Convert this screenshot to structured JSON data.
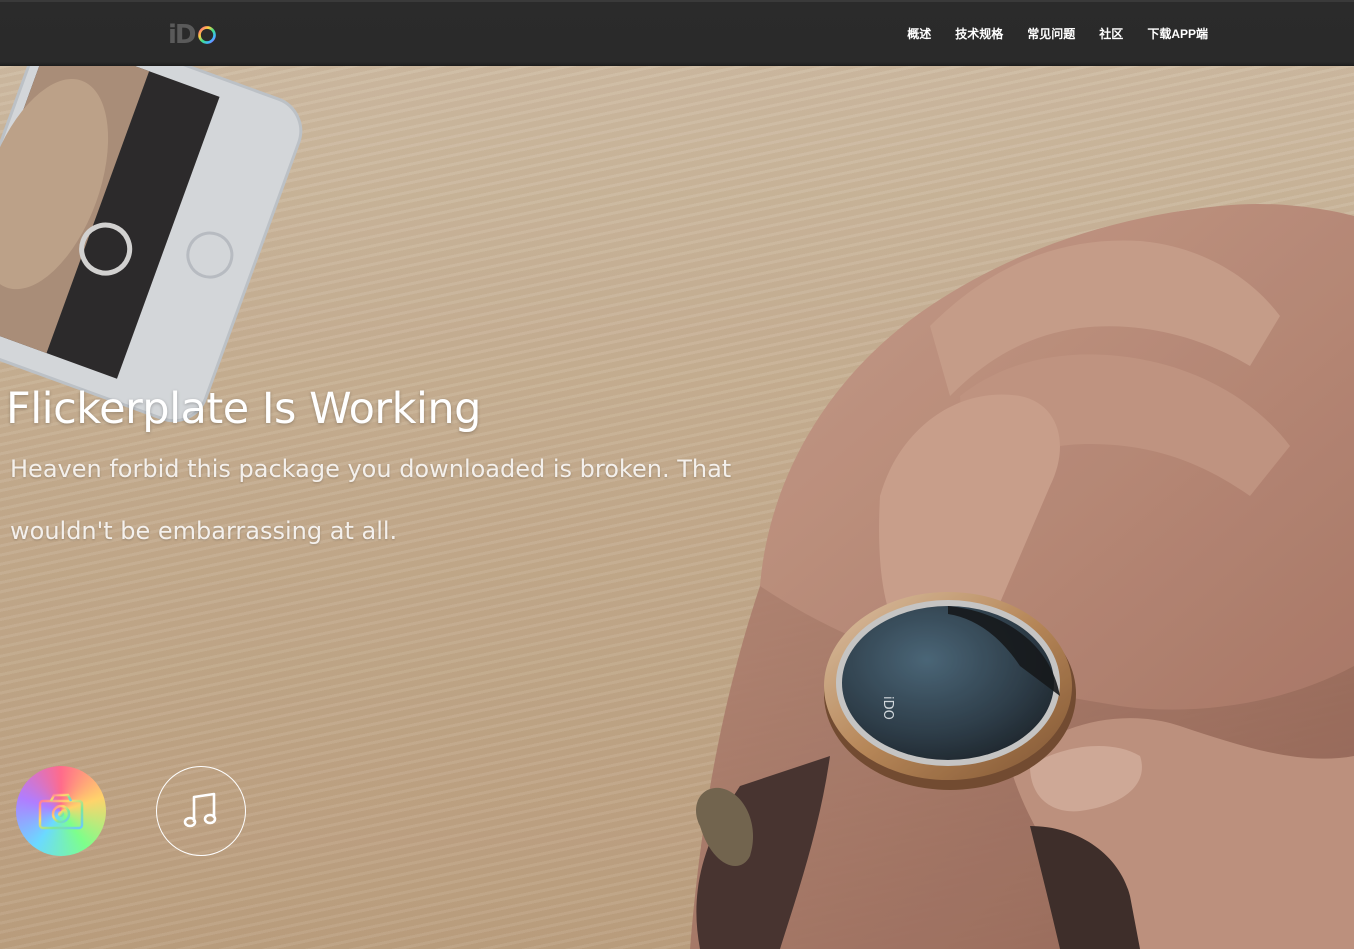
{
  "header": {
    "logo_text": "iD",
    "nav": [
      {
        "label": "概述"
      },
      {
        "label": "技术规格"
      },
      {
        "label": "常见问题"
      },
      {
        "label": "社区"
      },
      {
        "label": "下载APP端"
      }
    ]
  },
  "hero": {
    "title": "Flickerplate Is Working",
    "subtitle": "Heaven forbid this package you downloaded is broken. That wouldn't be embarrassing at all.",
    "watch_face_text": "iDO",
    "icons": [
      {
        "name": "camera-icon"
      },
      {
        "name": "music-icon"
      }
    ]
  },
  "colors": {
    "topbar_bg": "#2a2a2a",
    "nav_text": "#ffffff",
    "hero_text": "#ffffff"
  }
}
